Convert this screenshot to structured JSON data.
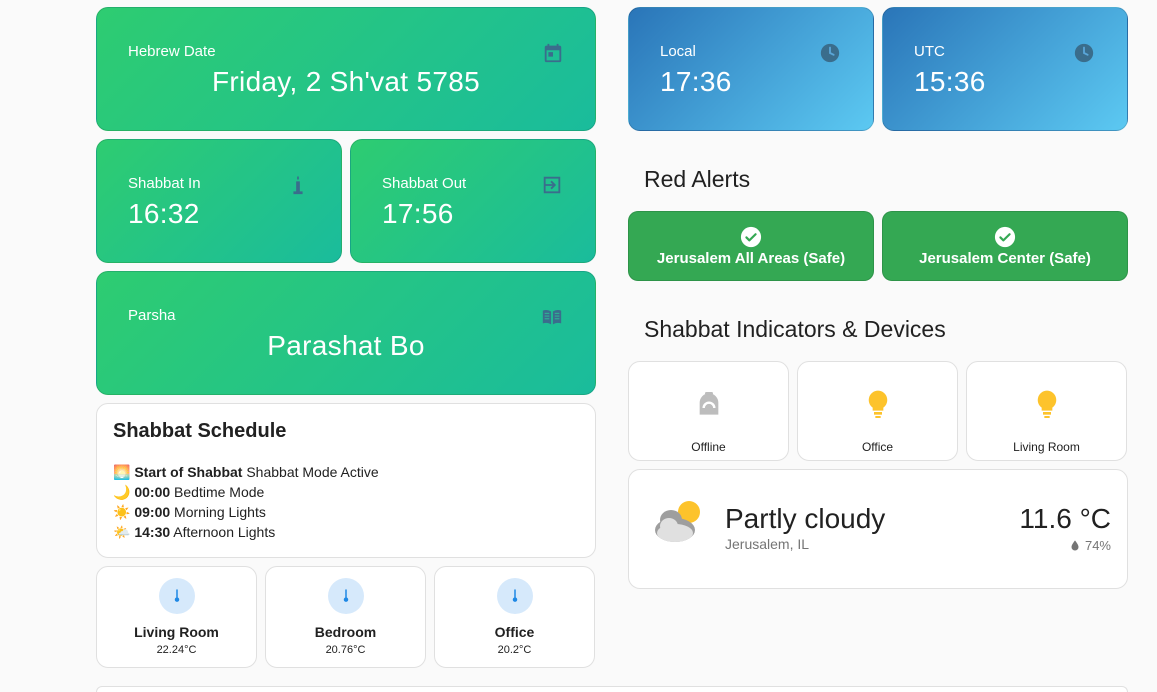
{
  "hebrew_date": {
    "label": "Hebrew Date",
    "value": "Friday, 2 Sh'vat 5785",
    "icon": "calendar-icon"
  },
  "local_time": {
    "label": "Local",
    "value": "17:36",
    "icon": "clock-icon"
  },
  "utc_time": {
    "label": "UTC",
    "value": "15:36",
    "icon": "clock-icon"
  },
  "shabbat_in": {
    "label": "Shabbat In",
    "value": "16:32",
    "icon": "candle-icon"
  },
  "shabbat_out": {
    "label": "Shabbat Out",
    "value": "17:56",
    "icon": "exit-icon"
  },
  "parsha": {
    "label": "Parsha",
    "value": "Parashat Bo",
    "icon": "book-icon"
  },
  "red_alerts": {
    "title": "Red Alerts",
    "items": [
      {
        "label": "Jerusalem All Areas (Safe)",
        "icon": "check-circle-icon"
      },
      {
        "label": "Jerusalem Center (Safe)",
        "icon": "check-circle-icon"
      }
    ]
  },
  "indicators": {
    "title": "Shabbat Indicators & Devices",
    "devices": [
      {
        "label": "Offline",
        "icon": "kettle-icon",
        "color": "#bdbdbd"
      },
      {
        "label": "Office",
        "icon": "lightbulb-icon",
        "color": "#fdc32b"
      },
      {
        "label": "Living Room",
        "icon": "lightbulb-icon",
        "color": "#fdc32b"
      }
    ]
  },
  "schedule": {
    "title": "Shabbat Schedule",
    "items": [
      {
        "emoji": "🌅",
        "time": "Start of Shabbat",
        "text": "Shabbat Mode Active"
      },
      {
        "emoji": "🌙",
        "time": "00:00",
        "text": "Bedtime Mode"
      },
      {
        "emoji": "☀️",
        "time": "09:00",
        "text": "Morning Lights"
      },
      {
        "emoji": "🌤️",
        "time": "14:30",
        "text": "Afternoon Lights"
      }
    ]
  },
  "sensors": [
    {
      "name": "Living Room",
      "value": "22.24°C",
      "icon": "thermometer-icon"
    },
    {
      "name": "Bedroom",
      "value": "20.76°C",
      "icon": "thermometer-icon"
    },
    {
      "name": "Office",
      "value": "20.2°C",
      "icon": "thermometer-icon"
    }
  ],
  "weather": {
    "condition": "Partly cloudy",
    "location": "Jerusalem, IL",
    "temperature": "11.6 °C",
    "humidity": "74%",
    "icon": "partly-cloudy-icon"
  },
  "colors": {
    "green_start": "#2ecc71",
    "green_end": "#1abc9c",
    "blue_start": "#2a75b8",
    "blue_end": "#5cc9f2",
    "alert_green": "#34a853",
    "icon_dark": "#3a6d8c"
  }
}
